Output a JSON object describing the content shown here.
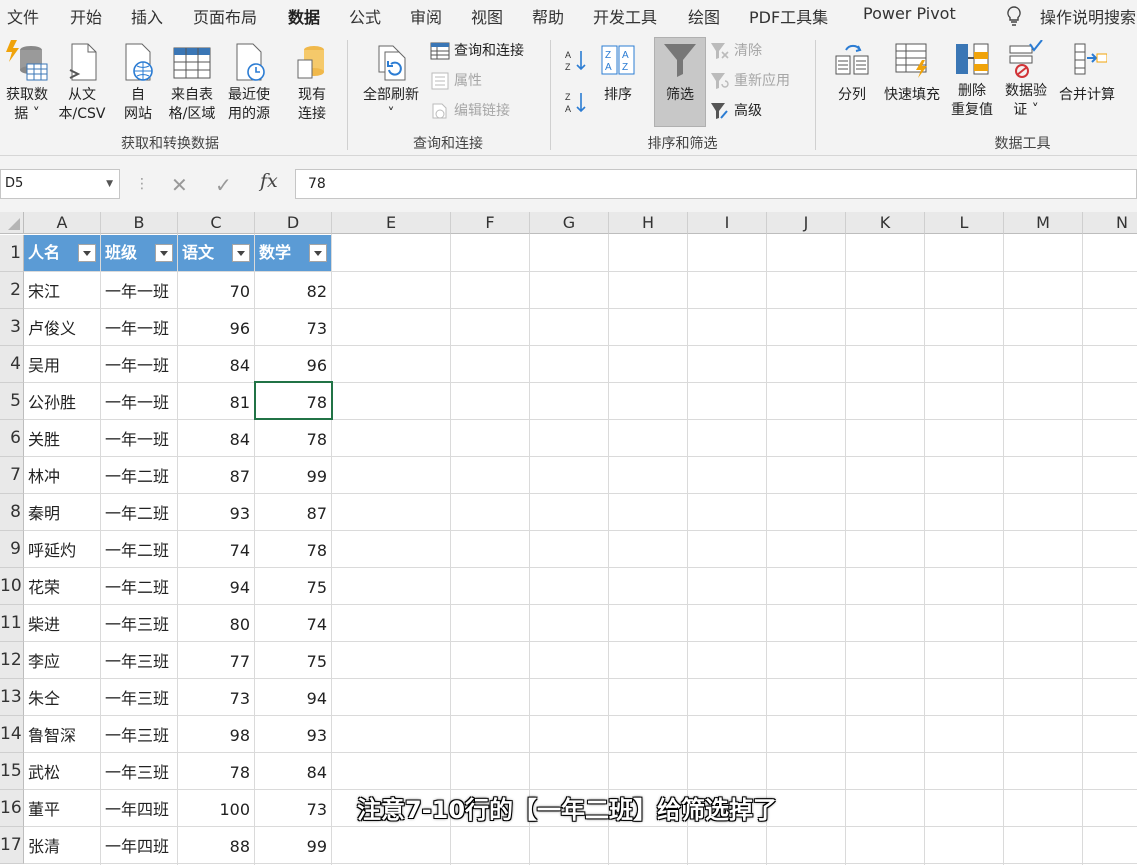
{
  "menu": [
    "文件",
    "开始",
    "插入",
    "页面布局",
    "数据",
    "公式",
    "审阅",
    "视图",
    "帮助",
    "开发工具",
    "绘图",
    "PDF工具集",
    "Power Pivot"
  ],
  "active_tab": "数据",
  "search_label": "操作说明搜索",
  "ribbon": {
    "get_data": [
      "获取数",
      "据 ˅"
    ],
    "from_text": [
      "从文",
      "本/CSV"
    ],
    "from_web": [
      "自",
      "网站"
    ],
    "from_table": [
      "来自表",
      "格/区域"
    ],
    "recent_sources": [
      "最近使",
      "用的源"
    ],
    "existing_conn": [
      "现有",
      "连接"
    ],
    "group_get": "获取和转换数据",
    "refresh_all": [
      "全部刷新",
      "˅"
    ],
    "queries_conn": "查询和连接",
    "properties": "属性",
    "edit_links": "编辑链接",
    "group_queries": "查询和连接",
    "sort": "排序",
    "filter": "筛选",
    "clear": "清除",
    "reapply": "重新应用",
    "advanced": "高级",
    "group_sort": "排序和筛选",
    "text_to_col": "分列",
    "flash_fill": "快速填充",
    "remove_dup": [
      "删除",
      "重复值"
    ],
    "validation": [
      "数据验",
      "证 ˅"
    ],
    "consolidate": "合并计算",
    "group_tools": "数据工具"
  },
  "formula_bar": {
    "name_box": "D5",
    "value": "78"
  },
  "columns": [
    "A",
    "B",
    "C",
    "D",
    "E",
    "F",
    "G",
    "H",
    "I",
    "J",
    "K",
    "L",
    "M",
    "N"
  ],
  "rows": [
    "1",
    "2",
    "3",
    "4",
    "5",
    "6",
    "7",
    "8",
    "9",
    "10",
    "11",
    "12",
    "13",
    "14",
    "15",
    "16",
    "17"
  ],
  "table": {
    "headers": [
      "人名",
      "班级",
      "语文",
      "数学"
    ],
    "rows": [
      [
        "宋江",
        "一年一班",
        "70",
        "82"
      ],
      [
        "卢俊义",
        "一年一班",
        "96",
        "73"
      ],
      [
        "吴用",
        "一年一班",
        "84",
        "96"
      ],
      [
        "公孙胜",
        "一年一班",
        "81",
        "78"
      ],
      [
        "关胜",
        "一年一班",
        "84",
        "78"
      ],
      [
        "林冲",
        "一年二班",
        "87",
        "99"
      ],
      [
        "秦明",
        "一年二班",
        "93",
        "87"
      ],
      [
        "呼延灼",
        "一年二班",
        "74",
        "78"
      ],
      [
        "花荣",
        "一年二班",
        "94",
        "75"
      ],
      [
        "柴进",
        "一年三班",
        "80",
        "74"
      ],
      [
        "李应",
        "一年三班",
        "77",
        "75"
      ],
      [
        "朱仝",
        "一年三班",
        "73",
        "94"
      ],
      [
        "鲁智深",
        "一年三班",
        "98",
        "93"
      ],
      [
        "武松",
        "一年三班",
        "78",
        "84"
      ],
      [
        "董平",
        "一年四班",
        "100",
        "73"
      ],
      [
        "张清",
        "一年四班",
        "88",
        "99"
      ]
    ]
  },
  "subtitle": "注意7-10行的【一年二班】给筛选掉了",
  "colors": {
    "header_fill": "#5b9bd5",
    "accent": "#217346"
  }
}
